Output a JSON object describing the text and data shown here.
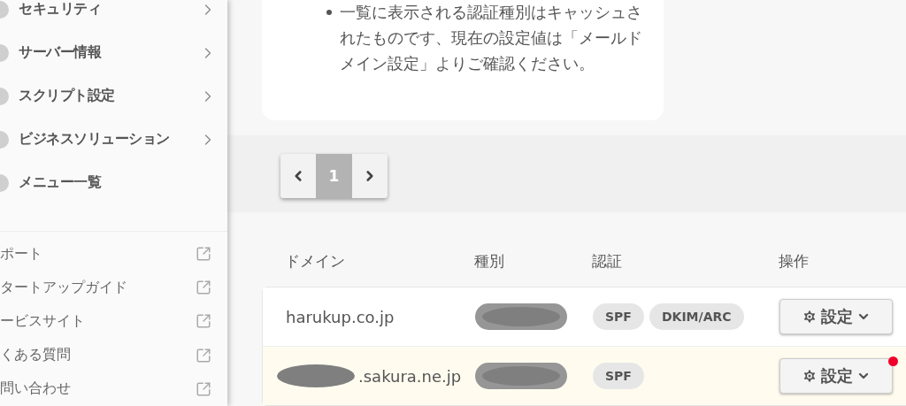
{
  "sidebar": {
    "nav_items": [
      {
        "label": "セキュリティ",
        "has_submenu": true
      },
      {
        "label": "サーバー情報",
        "has_submenu": true
      },
      {
        "label": "スクリプト設定",
        "has_submenu": true
      },
      {
        "label": "ビジネスソリューション",
        "has_submenu": true
      },
      {
        "label": "メニュー一覧",
        "has_submenu": false
      }
    ],
    "links": [
      {
        "label": "ポート"
      },
      {
        "label": "タートアップガイド"
      },
      {
        "label": "ービスサイト"
      },
      {
        "label": "くある質問"
      },
      {
        "label": "問い合わせ"
      }
    ]
  },
  "notice": {
    "items": [
      "一覧に表示される認証種別はキャッシュされたものです、現在の設定値は「メールドメイン設定」よりご確認ください。"
    ]
  },
  "pagination": {
    "pages": [
      {
        "label": "1",
        "selected": true
      }
    ]
  },
  "table": {
    "columns": [
      "ドメイン",
      "種別",
      "認証",
      "操作"
    ],
    "rows": [
      {
        "domain": "harukup.co.jp",
        "domain_redacted": false,
        "type_redacted": true,
        "auth": [
          "SPF",
          "DKIM/ARC"
        ],
        "action": "設定",
        "highlighted": false,
        "alert": false
      },
      {
        "domain": ".sakura.ne.jp",
        "domain_redacted": true,
        "type_redacted": true,
        "auth": [
          "SPF"
        ],
        "action": "設定",
        "highlighted": true,
        "alert": true
      }
    ]
  }
}
